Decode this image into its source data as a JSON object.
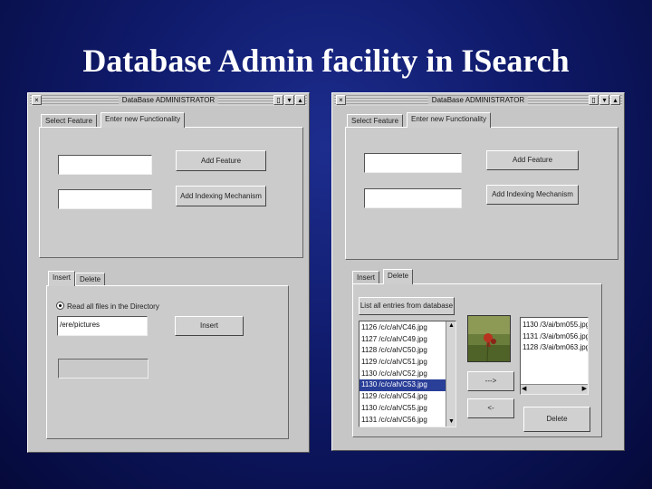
{
  "slide": {
    "title": "Database Admin facility in ISearch"
  },
  "left_window": {
    "title": "DataBase ADMINISTRATOR",
    "tabs": [
      "Select Feature",
      "Enter new Functionality"
    ],
    "add_feature_label": "Add Feature",
    "add_indexing_label": "Add Indexing Mechanism",
    "lower_tabs": [
      "Insert",
      "Delete"
    ],
    "radio_label": "Read all files in the Directory",
    "directory_value": "/ere/pictures",
    "insert_label": "Insert"
  },
  "right_window": {
    "title": "DataBase ADMINISTRATOR",
    "tabs": [
      "Select Feature",
      "Enter new Functionality"
    ],
    "add_feature_label": "Add Feature",
    "add_indexing_label": "Add Indexing Mechanism",
    "lower_tabs": [
      "Insert",
      "Delete"
    ],
    "list_all_label": "List all entries from database",
    "db_entries": [
      "1126 /c/c/ah/C46.jpg",
      "1127 /c/c/ah/C49.jpg",
      "1128 /c/c/ah/C50.jpg",
      "1129 /c/c/ah/C51.jpg",
      "1130 /c/c/ah/C52.jpg",
      "1130 /c/c/ah/C53.jpg",
      "1129 /c/c/ah/C54.jpg",
      "1130 /c/c/ah/C55.jpg",
      "1131 /c/c/ah/C56.jpg"
    ],
    "selected_index": 5,
    "right_list": [
      "1130 /3/ai/bm055.jpg",
      "1131 /3/ai/bm056.jpg",
      "1128 /3/ai/bm063.jpg"
    ],
    "move_right_label": "--->",
    "move_left_label": "<-",
    "delete_label": "Delete"
  }
}
